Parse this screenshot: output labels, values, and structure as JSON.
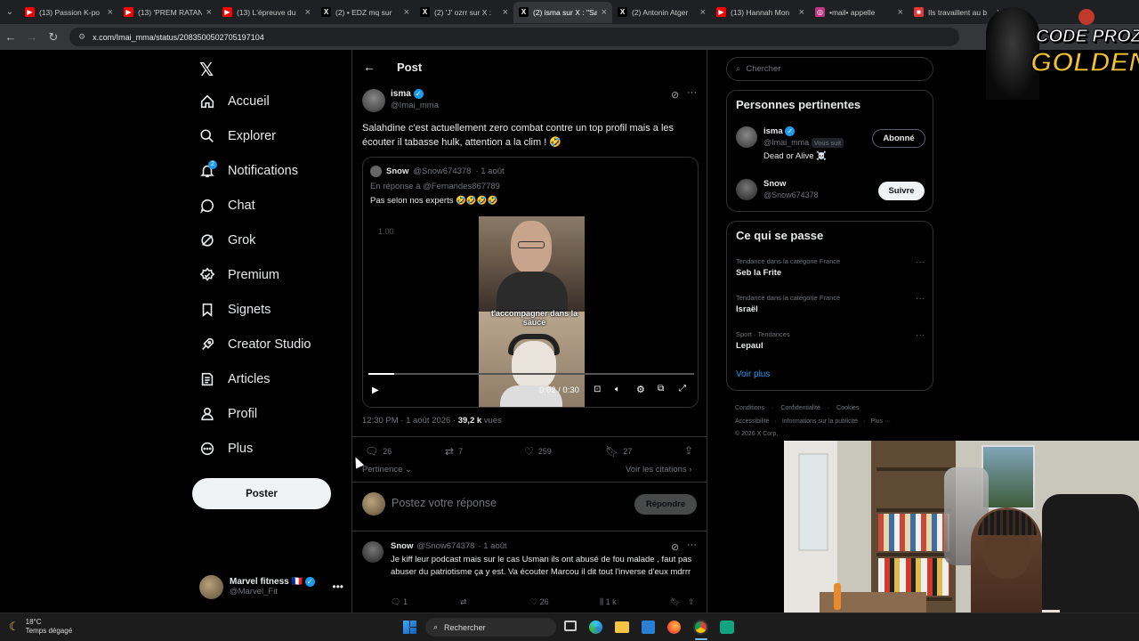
{
  "browser": {
    "tabs": [
      {
        "title": "(13) Passion K-po",
        "fav_color": "#ff0000",
        "fav_glyph": "▶"
      },
      {
        "title": "(13) 'PREM RATAN",
        "fav_color": "#ff0000",
        "fav_glyph": "▶"
      },
      {
        "title": "(13) L'épreuve du",
        "fav_color": "#ff0000",
        "fav_glyph": "▶"
      },
      {
        "title": "(2) • EDZ mq sur",
        "fav_color": "#000000",
        "fav_glyph": "X"
      },
      {
        "title": "(2) 'J' ozrr sur X :",
        "fav_color": "#000000",
        "fav_glyph": "X"
      },
      {
        "title": "(2) isma sur X : \"Sa",
        "fav_color": "#000000",
        "fav_glyph": "X"
      },
      {
        "title": "(2) Antonin Atger",
        "fav_color": "#000000",
        "fav_glyph": "X"
      },
      {
        "title": "(13) Hannah Mon",
        "fav_color": "#ff0000",
        "fav_glyph": "▶"
      },
      {
        "title": "•mail• appelle",
        "fav_color": "#c13584",
        "fav_glyph": "◎"
      },
      {
        "title": "Ils travaillent au b",
        "fav_color": "#e53935",
        "fav_glyph": "■"
      }
    ],
    "url": "x.com/Imai_mma/status/2083500502705197104"
  },
  "sidebar": {
    "items": [
      {
        "label": "Accueil",
        "icon": "home-icon"
      },
      {
        "label": "Explorer",
        "icon": "search-icon"
      },
      {
        "label": "Notifications",
        "icon": "bell-icon",
        "badge": "2"
      },
      {
        "label": "Chat",
        "icon": "chat-icon"
      },
      {
        "label": "Grok",
        "icon": "grok-icon"
      },
      {
        "label": "Premium",
        "icon": "premium-icon"
      },
      {
        "label": "Signets",
        "icon": "bookmark-icon"
      },
      {
        "label": "Creator Studio",
        "icon": "rocket-icon"
      },
      {
        "label": "Articles",
        "icon": "article-icon"
      },
      {
        "label": "Profil",
        "icon": "person-icon"
      },
      {
        "label": "Plus",
        "icon": "more-circle-icon"
      }
    ],
    "post_button": "Poster",
    "account": {
      "name": "Marvel fitness 🇫🇷",
      "handle": "@Marvel_Fit"
    }
  },
  "header": {
    "title": "Post"
  },
  "post": {
    "author": "isma",
    "handle": "@Imai_mma",
    "text": "Salahdine c'est actuellement zero combat contre un top profil mais a les écouter il tabasse hulk, attention a la clim ! 🤣",
    "quote": {
      "author": "Snow",
      "handle": "@Snow674378",
      "date": "· 1 août",
      "reply_to": "En réponse à @Fernandes867789",
      "text": "Pas selon nos experts 🤣🤣🤣🤣",
      "video": {
        "speed": "1.00",
        "caption": "t'accompagner dans la sauce",
        "time": "0:02 / 0:30",
        "progress": 0.08
      }
    },
    "timestamp": "12:30 PM · 1 août 2026 · ",
    "views_count": "39,2 k",
    "views_label": " vues",
    "stats": {
      "replies": "26",
      "reposts": "7",
      "likes": "259",
      "bookmarks": "27"
    },
    "sort_label": "Pertinence",
    "view_quotes": "Voir les citations"
  },
  "reply_box": {
    "placeholder": "Postez votre réponse",
    "button": "Répondre"
  },
  "reply": {
    "author": "Snow",
    "handle": "@Snow674378",
    "date": "· 1 août",
    "text": "Je kiff leur podcast mais sur le cas Usman ils ont abusé de fou malade , faut pas abuser du patriotisme ça y est. Va écouter Marcou il dit tout l'inverse d'eux mdrrr",
    "stats": {
      "replies": "1",
      "reposts": "",
      "likes": "26",
      "views": "1 k"
    }
  },
  "right": {
    "search_placeholder": "Chercher",
    "relevant": {
      "title": "Personnes pertinentes",
      "people": [
        {
          "name": "isma",
          "handle": "@Imai_mma",
          "follows_you": "Vous suit",
          "bio": "Dead or Alive ☠️",
          "button": "Abonné"
        },
        {
          "name": "Snow",
          "handle": "@Snow674378",
          "button": "Suivre"
        }
      ]
    },
    "trends": {
      "title": "Ce qui se passe",
      "items": [
        {
          "context": "Tendance dans la catégorie France",
          "name": "Seb la Frite"
        },
        {
          "context": "Tendance dans la catégorie France",
          "name": "Israël"
        },
        {
          "context": "Sport · Tendances",
          "name": "Lepaul"
        }
      ],
      "more": "Voir plus"
    },
    "footer": {
      "line1": [
        "Conditions",
        "·",
        "Confidentialité",
        "·",
        "Cookies"
      ],
      "line2": [
        "Accessibilité",
        "·",
        "Informations sur la publicité",
        "·",
        "Plus ···"
      ],
      "line3": "© 2026 X Corp."
    }
  },
  "overlay": {
    "logo_line1": "CODE PROZIS",
    "logo_line2": "GOLDENG"
  },
  "taskbar": {
    "temp": "18°C",
    "weather": "Temps dégagé",
    "search": "Rechercher"
  }
}
